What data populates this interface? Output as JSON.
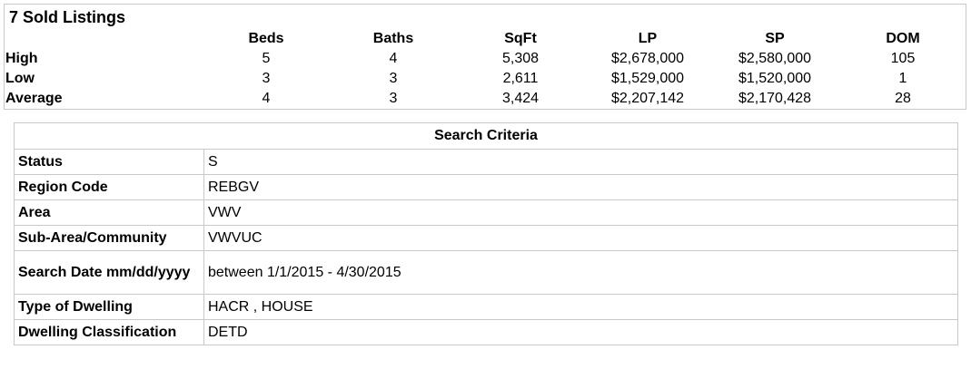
{
  "summary": {
    "title": "7 Sold Listings",
    "columns": [
      "Beds",
      "Baths",
      "SqFt",
      "LP",
      "SP",
      "DOM"
    ],
    "rows": [
      {
        "label": "High",
        "values": [
          "5",
          "4",
          "5,308",
          "$2,678,000",
          "$2,580,000",
          "105"
        ]
      },
      {
        "label": "Low",
        "values": [
          "3",
          "3",
          "2,611",
          "$1,529,000",
          "$1,520,000",
          "1"
        ]
      },
      {
        "label": "Average",
        "values": [
          "4",
          "3",
          "3,424",
          "$2,207,142",
          "$2,170,428",
          "28"
        ]
      }
    ]
  },
  "criteria": {
    "title": "Search Criteria",
    "rows": [
      {
        "key": "Status",
        "value": "S"
      },
      {
        "key": "Region Code",
        "value": "REBGV"
      },
      {
        "key": "Area",
        "value": "VWV"
      },
      {
        "key": "Sub-Area/Community",
        "value": "VWVUC"
      },
      {
        "key": "Search Date mm/dd/yyyy",
        "value": "between 1/1/2015 - 4/30/2015"
      },
      {
        "key": "Type of Dwelling",
        "value": "HACR , HOUSE"
      },
      {
        "key": "Dwelling Classification",
        "value": "DETD"
      }
    ]
  }
}
